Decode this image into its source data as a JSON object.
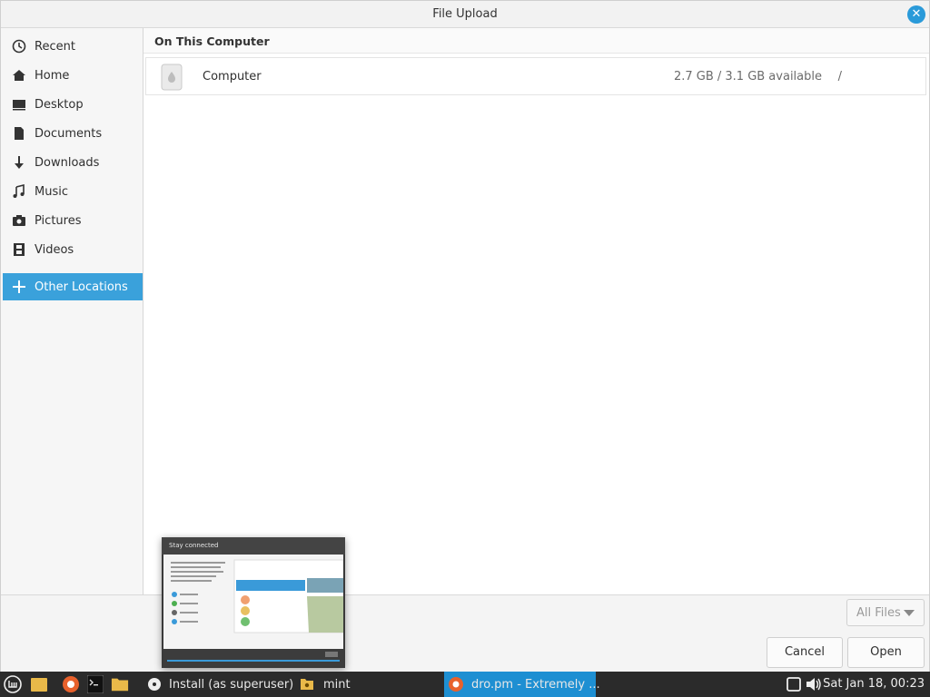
{
  "window": {
    "title": "File Upload"
  },
  "sidebar": {
    "items": [
      {
        "label": "Recent",
        "icon": "clock-icon"
      },
      {
        "label": "Home",
        "icon": "home-icon"
      },
      {
        "label": "Desktop",
        "icon": "desktop-icon"
      },
      {
        "label": "Documents",
        "icon": "document-icon"
      },
      {
        "label": "Downloads",
        "icon": "download-icon"
      },
      {
        "label": "Music",
        "icon": "music-icon"
      },
      {
        "label": "Pictures",
        "icon": "camera-icon"
      },
      {
        "label": "Videos",
        "icon": "film-icon"
      },
      {
        "label": "Other Locations",
        "icon": "plus-icon",
        "active": true
      }
    ]
  },
  "main": {
    "section_title": "On This Computer",
    "locations": [
      {
        "name": "Computer",
        "available": "2.7 GB / 3.1 GB available",
        "path": "/"
      }
    ]
  },
  "footer": {
    "filter_value": "All Files",
    "cancel_label": "Cancel",
    "open_label": "Open"
  },
  "preview": {
    "title": "Stay connected"
  },
  "taskbar": {
    "tasks": [
      {
        "label": "Install (as superuser)",
        "icon": "disc-icon"
      },
      {
        "label": "mint",
        "icon": "folder-icon"
      },
      {
        "label": "dro.pm - Extremely ...",
        "icon": "browser-icon",
        "active": true
      }
    ],
    "clock": "Sat Jan 18, 00:23"
  },
  "colors": {
    "accent": "#3aa1db",
    "taskbar_bg": "#2b2b2b",
    "taskbar_active": "#1e8fd2"
  }
}
